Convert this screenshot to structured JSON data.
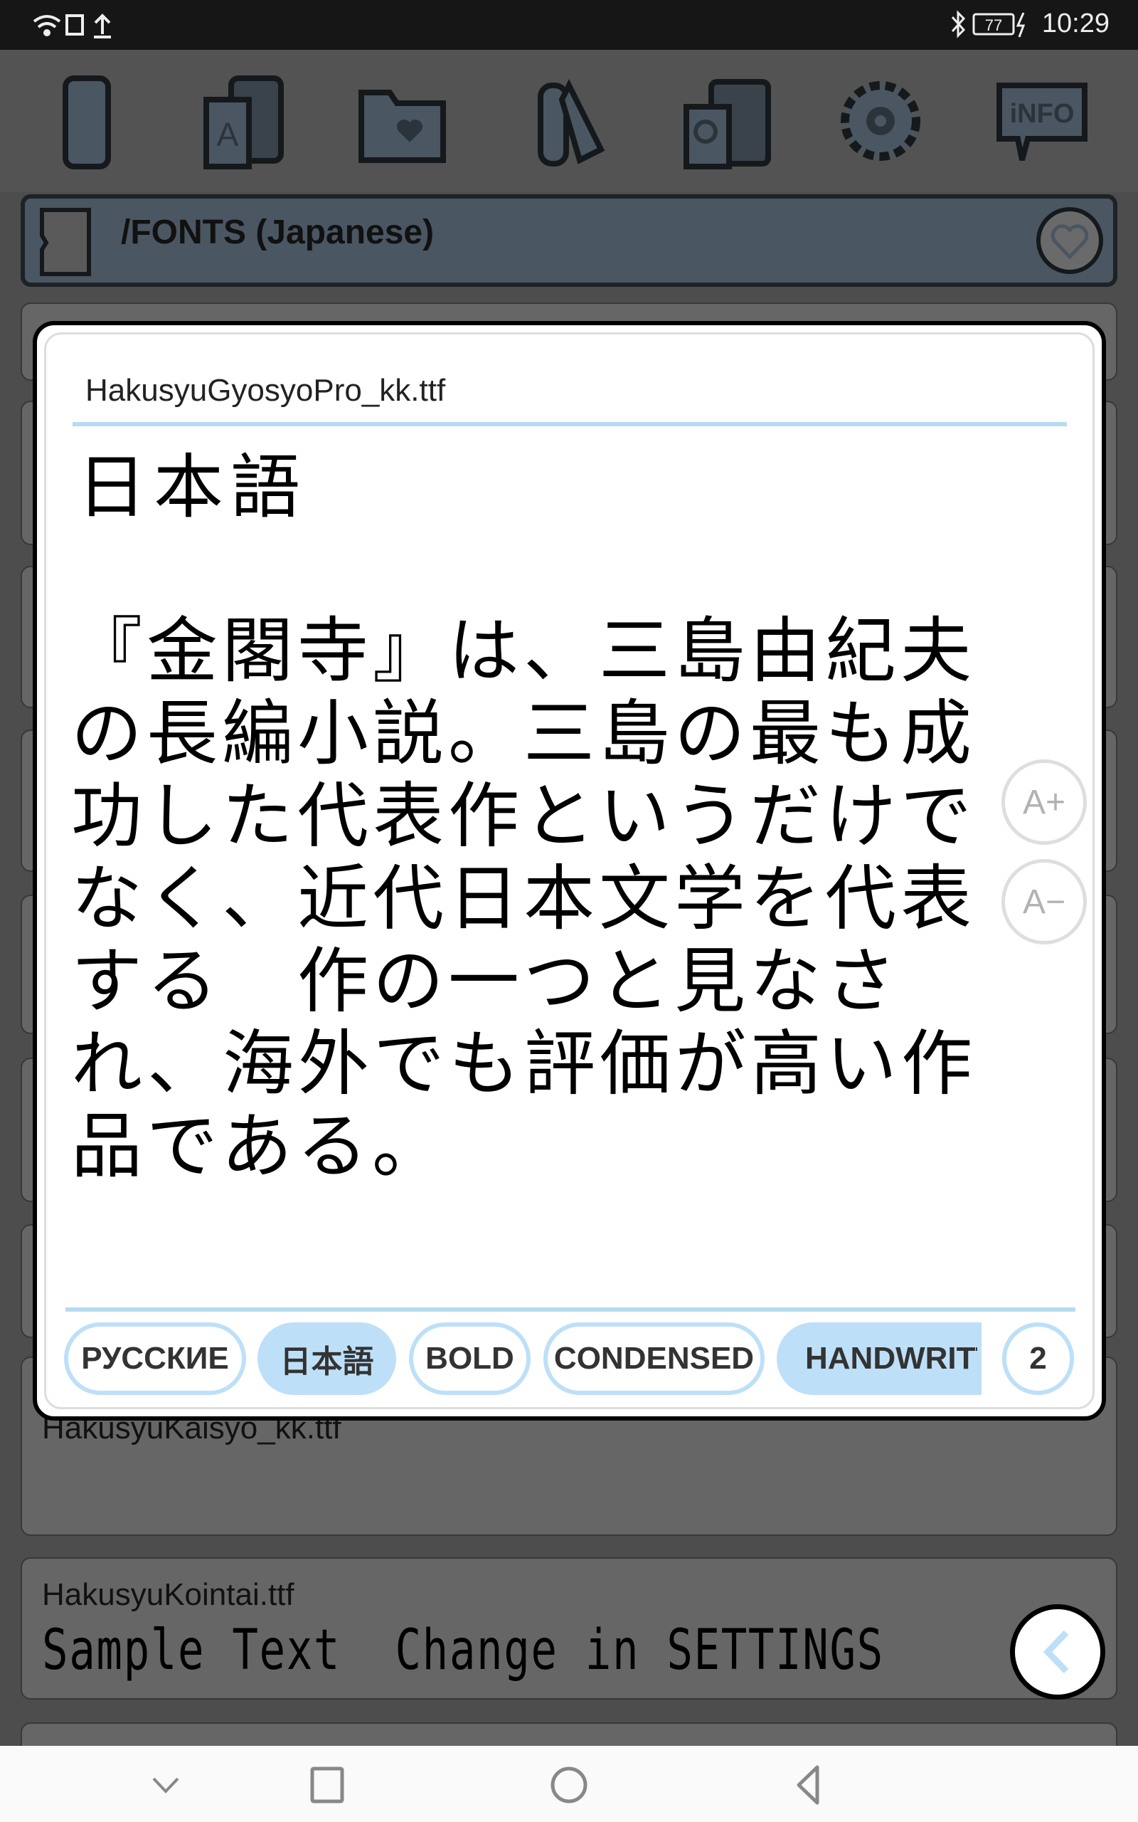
{
  "status_bar": {
    "battery": "77",
    "time": "10:29",
    "icons": [
      "wifi-icon",
      "sim-icon",
      "upload-icon",
      "bluetooth-icon",
      "battery-icon",
      "charging-icon"
    ]
  },
  "toolbar": {
    "icons": [
      "phone-icon",
      "font-device-icon",
      "favorite-folder-icon",
      "tags-icon",
      "search-list-icon",
      "gear-icon",
      "info-icon"
    ],
    "info_label": "iNFO"
  },
  "path_bar": {
    "path": "/FONTS (Japanese)",
    "icon": "sd-card-icon",
    "favorite_icon": "heart-icon"
  },
  "list": {
    "items": [
      {
        "filename": "HakusyuKaisyo_kk.ttf",
        "sample": ""
      },
      {
        "filename": "HakusyuKointai.ttf",
        "sample": "Sample Text  Change in SETTINGS"
      }
    ]
  },
  "dialog": {
    "filename": "HakusyuGyosyoPro_kk.ttf",
    "title": "日本語",
    "body_lines": [
      "『金閣寺』は、三島由紀夫",
      "の長編小説。三島の最も成",
      "功した代表作というだけで",
      "なく、近代日本文学を代表",
      "する　作の一つと見なさ",
      "れ、海外でも評価が高い作",
      "品である。"
    ],
    "zoom_in_label": "A+",
    "zoom_out_label": "A−",
    "chips": [
      {
        "label": "РУССКИЕ",
        "selected": false
      },
      {
        "label": "日本語",
        "selected": true
      },
      {
        "label": "BOLD",
        "selected": false
      },
      {
        "label": "CONDENSED",
        "selected": false
      },
      {
        "label": "HANDWRITTEN",
        "selected": true
      },
      {
        "label": "2",
        "selected": false
      }
    ]
  },
  "colors": {
    "accent": "#bde0f8",
    "fab_chevron": "#bde0f8",
    "path_bar": "#4a5662"
  },
  "nav_bar": {
    "icons": [
      "hide-nav-icon",
      "recents-icon",
      "home-icon",
      "back-icon"
    ]
  }
}
